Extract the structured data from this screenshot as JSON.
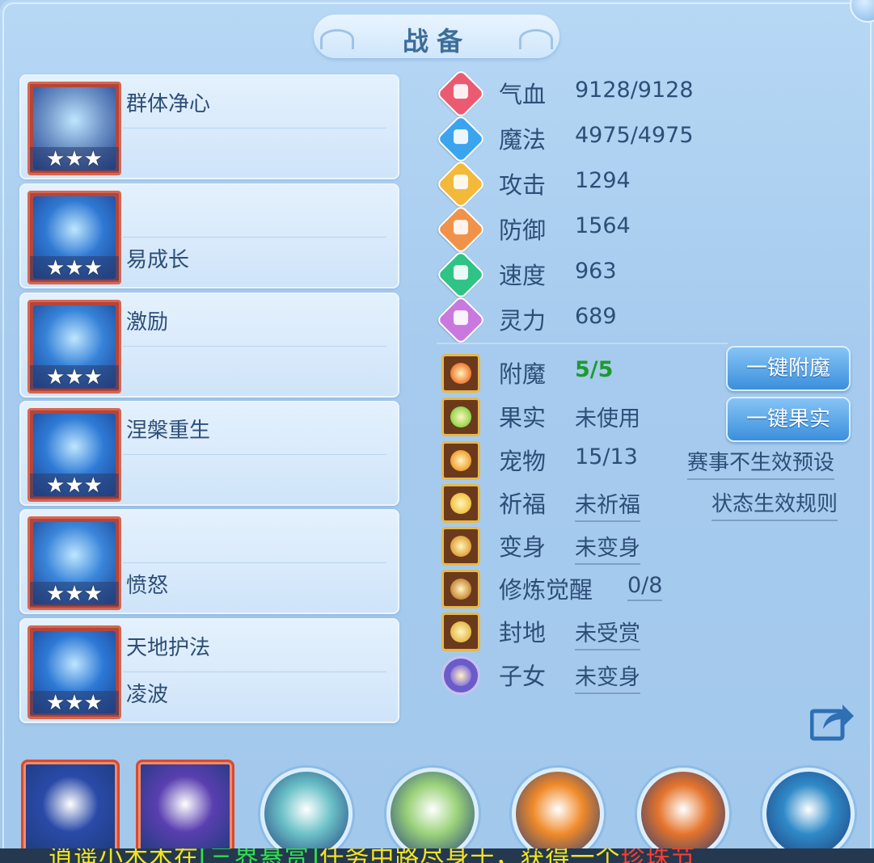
{
  "title": "战备",
  "skills": [
    {
      "top": "群体净心",
      "bottom": "",
      "stars": "★★★",
      "icon": "crossed-swords-icon",
      "color": "#6f94c8"
    },
    {
      "top": "",
      "bottom": "易成长",
      "stars": "★★★",
      "icon": "crowned-guardian-icon",
      "color": "#2f79d3"
    },
    {
      "top": "激励",
      "bottom": "",
      "stars": "★★★",
      "icon": "winged-helm-icon",
      "color": "#3582d8"
    },
    {
      "top": "涅槃重生",
      "bottom": "",
      "stars": "★★★",
      "icon": "phoenix-icon",
      "color": "#2f7bd6"
    },
    {
      "top": "",
      "bottom": "愤怒",
      "stars": "★★★",
      "icon": "golden-crown-icon",
      "color": "#3a86da"
    },
    {
      "top": "天地护法",
      "bottom": "凌波",
      "stars": "★★★",
      "icon": "twin-guardian-icon",
      "color": "#2d79d6"
    }
  ],
  "stats": [
    {
      "label": "气血",
      "value": "9128/9128",
      "icon": "heart-icon",
      "color": "#ea5b72"
    },
    {
      "label": "魔法",
      "value": "4975/4975",
      "icon": "mana-drop-icon",
      "color": "#3aa5ee"
    },
    {
      "label": "攻击",
      "value": "1294",
      "icon": "sword-icon",
      "color": "#f2b93a"
    },
    {
      "label": "防御",
      "value": "1564",
      "icon": "shield-icon",
      "color": "#f0924a"
    },
    {
      "label": "速度",
      "value": "963",
      "icon": "lightning-icon",
      "color": "#2fc386"
    },
    {
      "label": "灵力",
      "value": "689",
      "icon": "spirit-icon",
      "color": "#c978e0"
    }
  ],
  "attributes": [
    {
      "label": "附魔",
      "value": "5/5",
      "icon": "enchant-icon",
      "glow": "#f07a30"
    },
    {
      "label": "果实",
      "value": "未使用",
      "icon": "fruit-icon",
      "glow": "#8fd64a"
    },
    {
      "label": "宠物",
      "value": "15/13",
      "icon": "pet-icon",
      "glow": "#f0a030"
    },
    {
      "label": "祈福",
      "value": "未祈福",
      "icon": "blessing-icon",
      "glow": "#f2c240"
    },
    {
      "label": "变身",
      "value": "未变身",
      "icon": "transform-icon",
      "glow": "#e0a23a"
    },
    {
      "label": "修炼觉醒",
      "value": "0/8",
      "icon": "meditation-icon",
      "glow": "#c98a3a"
    },
    {
      "label": "封地",
      "value": "未受赏",
      "icon": "fief-icon",
      "glow": "#e6b94a"
    },
    {
      "label": "子女",
      "value": "未变身",
      "icon": "child-icon",
      "glow": "#8e7ad8"
    }
  ],
  "buttons": {
    "enchant": "一键附魔",
    "fruit": "一键果实"
  },
  "links": {
    "event_preset": "赛事不生效预设",
    "status_rules": "状态生效规则"
  },
  "bottom_slots": [
    {
      "shape": "square",
      "icon": "star-orb-icon",
      "color": "#2a4aa8"
    },
    {
      "shape": "square",
      "icon": "lotus-moon-icon",
      "color": "#5a3fb0"
    },
    {
      "shape": "round",
      "icon": "golden-figure-icon",
      "color": "#6cc2c8"
    },
    {
      "shape": "round",
      "icon": "green-leaf-icon",
      "color": "#9bd27a"
    },
    {
      "shape": "round",
      "icon": "fire-ring-icon",
      "color": "#f08a2a"
    },
    {
      "shape": "round",
      "icon": "lantern-icon",
      "color": "#e5742c"
    },
    {
      "shape": "round",
      "icon": "blue-wave-icon",
      "color": "#2f8ac8"
    }
  ],
  "ticker": {
    "part1": "逍遥小木木在",
    "part2": "[三界悬赏]",
    "part3": "任务中路尽身于，获得一个",
    "part4": "珍珠节"
  }
}
